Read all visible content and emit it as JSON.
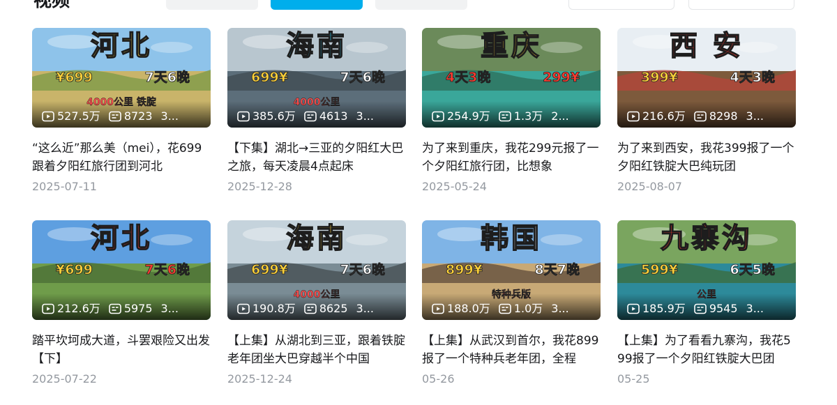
{
  "header": {
    "title": "视频"
  },
  "colors": {
    "accent": "#00aeec",
    "text": "#18191c",
    "muted": "#9499a0",
    "title_yellow": "#ffd23a",
    "title_red": "#ff3b30",
    "title_cyan": "#35d6ff"
  },
  "icons": {
    "play": "play-count-icon",
    "danmaku": "danmaku-count-icon"
  },
  "videos": [
    {
      "overlay_title": "河北",
      "overlay_title_color": "#ffd23a",
      "overlay_price": "¥699",
      "overlay_days": "7天6晚",
      "overlay_sub": "4000公里 铁腚",
      "plays": "527.5万",
      "danmaku": "8723",
      "duration": "3...",
      "title": "“这么近”那么美（mei），花699跟着夕阳红旅行团到河北",
      "date": "2025-07-11"
    },
    {
      "overlay_title": "海南",
      "overlay_title_color": "#35d6ff",
      "overlay_price": "699¥",
      "overlay_days": "7天6晚",
      "overlay_sub": "4000公里",
      "plays": "385.6万",
      "danmaku": "4613",
      "duration": "3...",
      "title": "【下集】湖北→三亚的夕阳红大巴之旅，每天凌晨4点起床",
      "date": "2025-12-28"
    },
    {
      "overlay_title": "重庆",
      "overlay_title_color": "#ffd23a",
      "overlay_price": "4天3晚",
      "overlay_days": "299¥",
      "overlay_sub": "",
      "plays": "254.9万",
      "danmaku": "1.3万",
      "duration": "2...",
      "title": "为了来到重庆，我花299元报了一个夕阳红旅行团，比想象",
      "date": "2025-05-24"
    },
    {
      "overlay_title": "西 安",
      "overlay_title_color": "#ff3b30",
      "overlay_price": "399¥",
      "overlay_days": "4天3晚",
      "overlay_sub": "",
      "plays": "216.6万",
      "danmaku": "8298",
      "duration": "3...",
      "title": "为了来到西安，我花399报了一个夕阳红铁腚大巴纯玩团",
      "date": "2025-08-07"
    },
    {
      "overlay_title": "河北",
      "overlay_title_color": "#ff3b30",
      "overlay_price": "¥699",
      "overlay_days": "7天6晚",
      "overlay_sub": "",
      "plays": "212.6万",
      "danmaku": "5975",
      "duration": "3...",
      "title": "踏平坎坷成大道，斗罢艰险又出发【下】",
      "date": "2025-07-22"
    },
    {
      "overlay_title": "海南",
      "overlay_title_color": "#ffd23a",
      "overlay_price": "699¥",
      "overlay_days": "7天6晚",
      "overlay_sub": "4000公里",
      "plays": "190.8万",
      "danmaku": "8625",
      "duration": "3...",
      "title": "【上集】从湖北到三亚，跟着铁腚老年团坐大巴穿越半个中国",
      "date": "2025-12-24"
    },
    {
      "overlay_title": "韩国",
      "overlay_title_color": "#ffffff",
      "overlay_price": "899¥",
      "overlay_days": "8天7晚",
      "overlay_sub": "特种兵版",
      "plays": "188.0万",
      "danmaku": "1.0万",
      "duration": "3...",
      "title": "【上集】从武汉到首尔，我花899报了一个特种兵老年团，全程",
      "date": "05-26"
    },
    {
      "overlay_title": "九寨沟",
      "overlay_title_color": "#ff3b30",
      "overlay_price": "599¥",
      "overlay_days": "6天5晚",
      "overlay_sub": "公里",
      "plays": "185.9万",
      "danmaku": "9545",
      "duration": "3...",
      "title": "【上集】为了看看九寨沟，我花599报了一个夕阳红铁腚大巴团",
      "date": "05-25"
    }
  ]
}
